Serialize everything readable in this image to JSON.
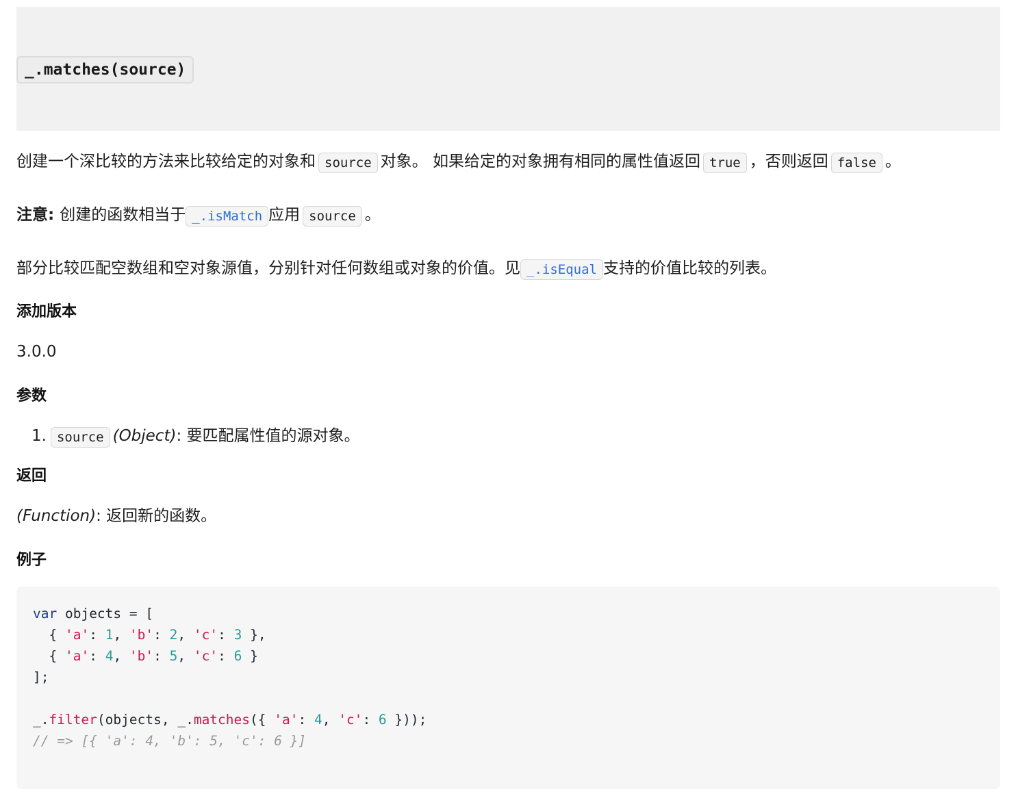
{
  "signature": "_.matches(source)",
  "description": {
    "p1": "创建一个深比较的方法来比较给定的对象和",
    "code_source": "source",
    "p2": "对象。 如果给定的对象拥有相同的属性值返回",
    "code_true": "true",
    "p3": "，否则返回",
    "code_false": "false",
    "p4": "。"
  },
  "note": {
    "label": "注意:",
    "p1": "创建的函数相当于",
    "link_ismatch": "_.isMatch",
    "p2": "应用",
    "code_source": "source",
    "p3": "。"
  },
  "partial": {
    "p1": "部分比较匹配空数组和空对象源值，分别针对任何数组或对象的价值。见",
    "link_isequal": "_.isEqual",
    "p2": "支持的价值比较的列表。"
  },
  "since": {
    "heading": "添加版本",
    "value": "3.0.0"
  },
  "params": {
    "heading": "参数",
    "items": [
      {
        "num": "1.",
        "name": "source",
        "type": "(Object)",
        "desc": ": 要匹配属性值的源对象。"
      }
    ]
  },
  "returns": {
    "heading": "返回",
    "type": "(Function)",
    "desc": ": 返回新的函数。"
  },
  "example": {
    "heading": "例子",
    "code_lines": [
      "var objects = [",
      "  { 'a': 1, 'b': 2, 'c': 3 },",
      "  { 'a': 4, 'b': 5, 'c': 6 }",
      "];",
      "",
      "_.filter(objects, _.matches({ 'a': 4, 'c': 6 }));",
      "// => [{ 'a': 4, 'b': 5, 'c': 6 }]"
    ]
  }
}
